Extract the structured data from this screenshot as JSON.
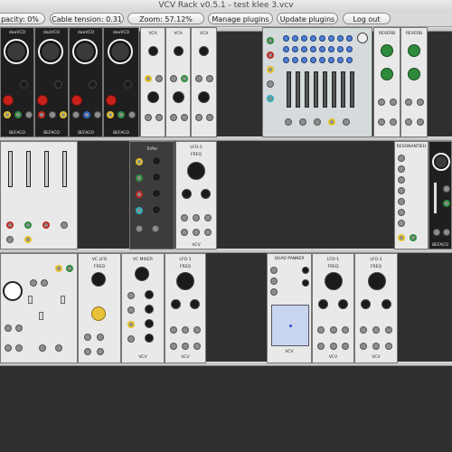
{
  "window": {
    "title": "VCV Rack v0.5.1 - test klee 3.vcv"
  },
  "toolbar": {
    "capacity": "pacity: 0%",
    "cable_tension": "Cable tension: 0.31",
    "zoom": "Zoom: 57.12%",
    "manage_plugins": "Manage plugins",
    "update_plugins": "Update plugins",
    "log_out": "Log out"
  },
  "modules": {
    "vco_label": "dooVCO",
    "befaco": "BEFACO",
    "vca": "VCA",
    "reverb": "REVERB",
    "lfo1": "LFO-1",
    "freq": "FREQ",
    "vco_lfo": "VC LFO",
    "vc_mixer": "VC MIXER",
    "quad_panner": "QUAD PANNER",
    "resonantiteh": "RESONANTIEH",
    "vcv": "VCV",
    "tri_pie": "TriPie"
  },
  "colors": {
    "rack": "#2e2e2e",
    "panel_light": "#e9e9e9",
    "panel_dark": "#1f1f1f",
    "rail": "#c8c8c8"
  }
}
